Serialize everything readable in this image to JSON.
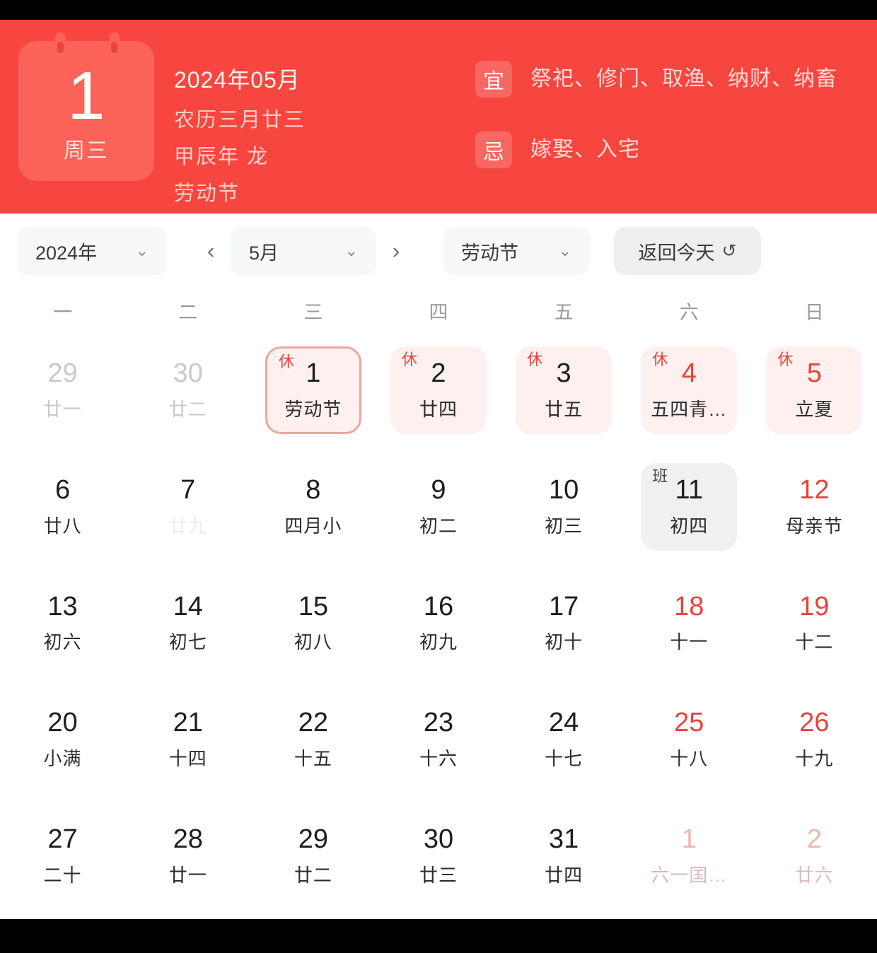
{
  "header": {
    "bg_color": "#f7463f",
    "card": {
      "day": "1",
      "weekday": "周三"
    },
    "year_month": "2024年05月",
    "lunar": "农历三月廿三",
    "ganzhi": "甲辰年 龙",
    "festival": "劳动节",
    "yi": {
      "label": "宜",
      "items": "祭祀、修门、取渔、纳财、纳畜"
    },
    "ji": {
      "label": "忌",
      "items": "嫁娶、入宅"
    }
  },
  "toolbar": {
    "year": "2024年",
    "month": "5月",
    "festival": "劳动节",
    "today": "返回今天",
    "refresh_icon": "↺",
    "chevron": "⌄",
    "prev_icon": "‹",
    "next_icon": "›"
  },
  "weekdays": [
    "一",
    "二",
    "三",
    "四",
    "五",
    "六",
    "日"
  ],
  "accent": {
    "red": "#e8433c",
    "rest_bg": "#fdf0ee",
    "work_bg": "#eff0f1",
    "selected_border": "#e9a8a0"
  },
  "weeks": [
    [
      {
        "num": "29",
        "lunar": "廿一",
        "state": "other"
      },
      {
        "num": "30",
        "lunar": "廿二",
        "state": "other"
      },
      {
        "num": "1",
        "lunar": "劳动节",
        "state": "selected",
        "badge": "休"
      },
      {
        "num": "2",
        "lunar": "廿四",
        "state": "rest",
        "badge": "休"
      },
      {
        "num": "3",
        "lunar": "廿五",
        "state": "rest",
        "badge": "休"
      },
      {
        "num": "4",
        "lunar": "五四青…",
        "state": "rest weekend",
        "badge": "休"
      },
      {
        "num": "5",
        "lunar": "立夏",
        "state": "rest weekend",
        "badge": "休"
      }
    ],
    [
      {
        "num": "6",
        "lunar": "廿八",
        "state": "normal"
      },
      {
        "num": "7",
        "lunar": "廿九",
        "state": "faded"
      },
      {
        "num": "8",
        "lunar": "四月小",
        "state": "normal"
      },
      {
        "num": "9",
        "lunar": "初二",
        "state": "normal"
      },
      {
        "num": "10",
        "lunar": "初三",
        "state": "normal"
      },
      {
        "num": "11",
        "lunar": "初四",
        "state": "work",
        "badge": "班"
      },
      {
        "num": "12",
        "lunar": "母亲节",
        "state": "weekend"
      }
    ],
    [
      {
        "num": "13",
        "lunar": "初六",
        "state": "normal"
      },
      {
        "num": "14",
        "lunar": "初七",
        "state": "normal"
      },
      {
        "num": "15",
        "lunar": "初八",
        "state": "normal"
      },
      {
        "num": "16",
        "lunar": "初九",
        "state": "normal"
      },
      {
        "num": "17",
        "lunar": "初十",
        "state": "normal"
      },
      {
        "num": "18",
        "lunar": "十一",
        "state": "weekend"
      },
      {
        "num": "19",
        "lunar": "十二",
        "state": "weekend"
      }
    ],
    [
      {
        "num": "20",
        "lunar": "小满",
        "state": "normal"
      },
      {
        "num": "21",
        "lunar": "十四",
        "state": "normal"
      },
      {
        "num": "22",
        "lunar": "十五",
        "state": "normal"
      },
      {
        "num": "23",
        "lunar": "十六",
        "state": "normal"
      },
      {
        "num": "24",
        "lunar": "十七",
        "state": "normal"
      },
      {
        "num": "25",
        "lunar": "十八",
        "state": "weekend"
      },
      {
        "num": "26",
        "lunar": "十九",
        "state": "weekend"
      }
    ],
    [
      {
        "num": "27",
        "lunar": "二十",
        "state": "normal"
      },
      {
        "num": "28",
        "lunar": "廿一",
        "state": "normal"
      },
      {
        "num": "29",
        "lunar": "廿二",
        "state": "normal"
      },
      {
        "num": "30",
        "lunar": "廿三",
        "state": "normal"
      },
      {
        "num": "31",
        "lunar": "廿四",
        "state": "normal"
      },
      {
        "num": "1",
        "lunar": "六一国…",
        "state": "other-red"
      },
      {
        "num": "2",
        "lunar": "廿六",
        "state": "other-red"
      }
    ]
  ]
}
